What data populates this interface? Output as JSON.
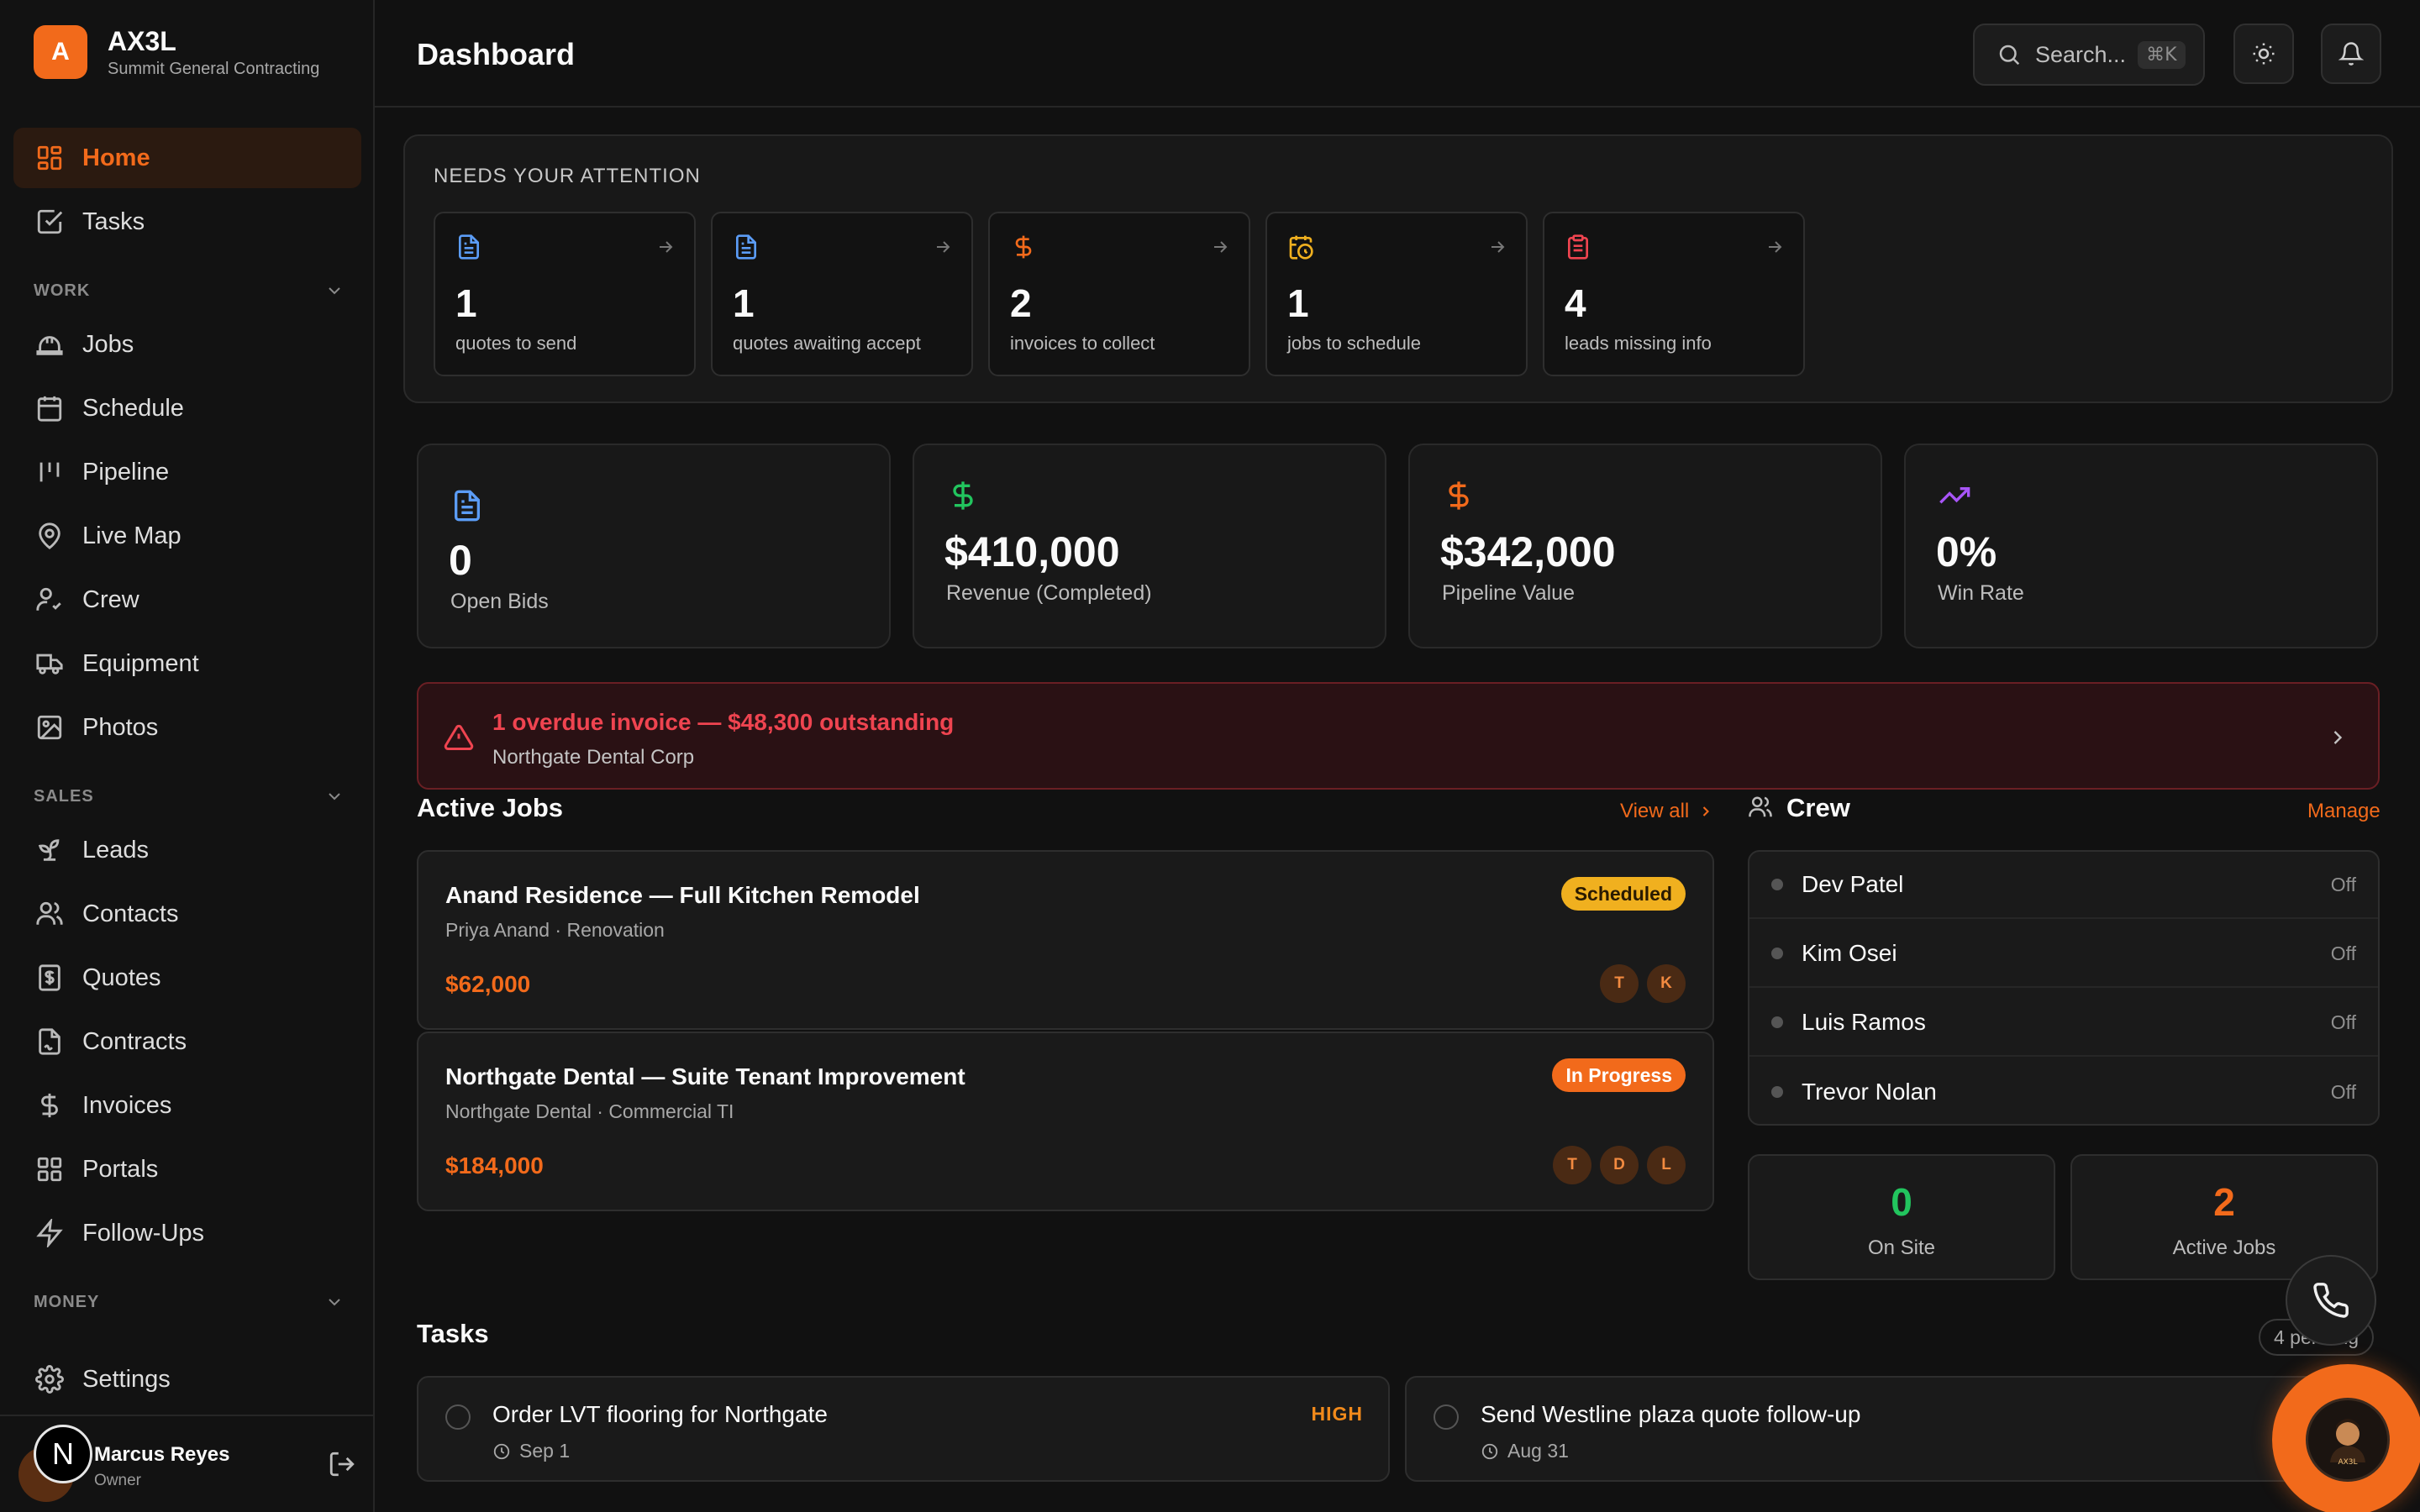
{
  "brand": {
    "logo_letter": "A",
    "name": "AX3L",
    "subtitle": "Summit General Contracting",
    "accent": "#f26a1b"
  },
  "sidebar": {
    "top_items": [
      {
        "label": "Home",
        "icon": "dashboard-grid-icon",
        "active": true
      },
      {
        "label": "Tasks",
        "icon": "checkbox-icon"
      }
    ],
    "sections": [
      {
        "label": "WORK",
        "items": [
          {
            "label": "Jobs",
            "icon": "hard-hat-icon"
          },
          {
            "label": "Schedule",
            "icon": "calendar-icon"
          },
          {
            "label": "Pipeline",
            "icon": "pipeline-bars-icon"
          },
          {
            "label": "Live Map",
            "icon": "map-pin-icon"
          },
          {
            "label": "Crew",
            "icon": "user-check-icon"
          },
          {
            "label": "Equipment",
            "icon": "truck-icon"
          },
          {
            "label": "Photos",
            "icon": "image-icon"
          }
        ]
      },
      {
        "label": "SALES",
        "items": [
          {
            "label": "Leads",
            "icon": "sprout-icon"
          },
          {
            "label": "Contacts",
            "icon": "users-icon"
          },
          {
            "label": "Quotes",
            "icon": "receipt-icon"
          },
          {
            "label": "Contracts",
            "icon": "file-signature-icon"
          },
          {
            "label": "Invoices",
            "icon": "dollar-icon"
          },
          {
            "label": "Portals",
            "icon": "grid-icon"
          },
          {
            "label": "Follow-Ups",
            "icon": "lightning-icon"
          }
        ]
      },
      {
        "label": "MONEY"
      }
    ],
    "settings_label": "Settings",
    "user": {
      "initial": "N",
      "name": "Marcus Reyes",
      "role": "Owner"
    }
  },
  "header": {
    "title": "Dashboard",
    "search_placeholder": "Search...",
    "search_shortcut": "⌘K"
  },
  "attention": {
    "title": "NEEDS YOUR ATTENTION",
    "cards": [
      {
        "value": "1",
        "label": "quotes to send",
        "icon": "document-icon",
        "color": "#5b9cf6"
      },
      {
        "value": "1",
        "label": "quotes awaiting accept",
        "icon": "document-icon",
        "color": "#5b9cf6"
      },
      {
        "value": "2",
        "label": "invoices to collect",
        "icon": "dollar-icon",
        "color": "#f26a1b"
      },
      {
        "value": "1",
        "label": "jobs to schedule",
        "icon": "calendar-clock-icon",
        "color": "#f0b01f"
      },
      {
        "value": "4",
        "label": "leads missing info",
        "icon": "clipboard-icon",
        "color": "#ef4450"
      }
    ]
  },
  "kpis": [
    {
      "value": "0",
      "label": "Open Bids",
      "icon": "document-icon",
      "color": "#5b9cf6"
    },
    {
      "value": "$410,000",
      "label": "Revenue (Completed)",
      "icon": "dollar-icon",
      "color": "#22c55e"
    },
    {
      "value": "$342,000",
      "label": "Pipeline Value",
      "icon": "dollar-icon",
      "color": "#f26a1b"
    },
    {
      "value": "0%",
      "label": "Win Rate",
      "icon": "trending-up-icon",
      "color": "#a855f7"
    }
  ],
  "alert": {
    "title": "1 overdue invoice — $48,300 outstanding",
    "subtitle": "Northgate Dental Corp"
  },
  "active_jobs": {
    "title": "Active Jobs",
    "view_all": "View all",
    "jobs": [
      {
        "title": "Anand Residence — Full Kitchen Remodel",
        "subtitle": "Priya Anand · Renovation",
        "amount": "$62,000",
        "status": "Scheduled",
        "crew": [
          "T",
          "K"
        ]
      },
      {
        "title": "Northgate Dental — Suite Tenant Improvement",
        "subtitle": "Northgate Dental · Commercial TI",
        "amount": "$184,000",
        "status": "In Progress",
        "crew": [
          "T",
          "D",
          "L"
        ]
      }
    ]
  },
  "crew": {
    "title": "Crew",
    "manage": "Manage",
    "members": [
      {
        "name": "Dev Patel",
        "status": "Off"
      },
      {
        "name": "Kim Osei",
        "status": "Off"
      },
      {
        "name": "Luis Ramos",
        "status": "Off"
      },
      {
        "name": "Trevor Nolan",
        "status": "Off"
      }
    ],
    "stats": [
      {
        "value": "0",
        "label": "On Site",
        "color": "#22c55e"
      },
      {
        "value": "2",
        "label": "Active Jobs",
        "color": "#f26a1b"
      }
    ]
  },
  "tasks": {
    "title": "Tasks",
    "pending": "4 pending",
    "items": [
      {
        "title": "Order LVT flooring for Northgate",
        "date": "Sep 1",
        "priority": "HIGH"
      },
      {
        "title": "Send Westline plaza quote follow-up",
        "date": "Aug 31",
        "priority": ""
      }
    ]
  }
}
